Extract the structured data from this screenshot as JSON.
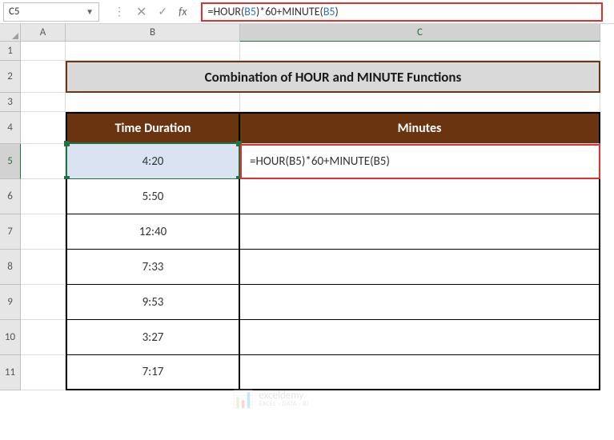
{
  "name_box": "C5",
  "formula_text_pre1": "=HOUR(",
  "formula_ref1": "B5",
  "formula_text_mid": ")*60+MINUTE(",
  "formula_ref2": "B5",
  "formula_text_post": ")",
  "columns": {
    "A": "A",
    "B": "B",
    "C": "C"
  },
  "rows": {
    "r1": "1",
    "r2": "2",
    "r3": "3",
    "r4": "4",
    "r5": "5",
    "r6": "6",
    "r7": "7",
    "r8": "8",
    "r9": "9",
    "r10": "10",
    "r11": "11"
  },
  "title": "Combination of HOUR and MINUTE Functions",
  "headers": {
    "time": "Time Duration",
    "minutes": "Minutes"
  },
  "table": {
    "r5": "4:20",
    "r6": "5:50",
    "r7": "12:40",
    "r8": "7:33",
    "r9": "9:53",
    "r10": "3:27",
    "r11": "7:17"
  },
  "cell_c5": "=HOUR(B5)*60+MINUTE(B5)",
  "watermark": {
    "name": "exceldemy",
    "sub": "EXCEL · DATA · BI"
  },
  "chart_data": {
    "type": "table",
    "title": "Combination of HOUR and MINUTE Functions",
    "columns": [
      "Time Duration",
      "Minutes"
    ],
    "rows": [
      [
        "4:20",
        "=HOUR(B5)*60+MINUTE(B5)"
      ],
      [
        "5:50",
        ""
      ],
      [
        "12:40",
        ""
      ],
      [
        "7:33",
        ""
      ],
      [
        "9:53",
        ""
      ],
      [
        "3:27",
        ""
      ],
      [
        "7:17",
        ""
      ]
    ]
  }
}
